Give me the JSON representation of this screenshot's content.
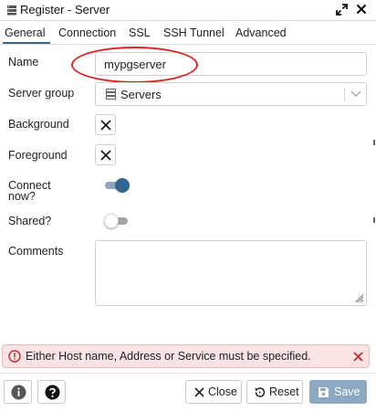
{
  "window": {
    "title": "Register - Server"
  },
  "tabs": [
    {
      "label": "General"
    },
    {
      "label": "Connection"
    },
    {
      "label": "SSL"
    },
    {
      "label": "SSH Tunnel"
    },
    {
      "label": "Advanced"
    }
  ],
  "form": {
    "name": {
      "label": "Name",
      "value": "mypgserver"
    },
    "server_group": {
      "label": "Server group",
      "value": "Servers"
    },
    "background": {
      "label": "Background"
    },
    "foreground": {
      "label": "Foreground"
    },
    "connect_now": {
      "label_line1": "Connect",
      "label_line2": "now?",
      "enabled": true
    },
    "shared": {
      "label": "Shared?",
      "enabled": false
    },
    "comments": {
      "label": "Comments",
      "value": ""
    }
  },
  "error": {
    "message": "Either Host name, Address or Service must be specified."
  },
  "footer": {
    "close_label": "Close",
    "reset_label": "Reset",
    "save_label": "Save"
  },
  "colors": {
    "accent": "#326690",
    "save_button": "#8da8c3",
    "error_background": "#f9e3e4",
    "error_icon": "#c7282f",
    "annotation": "#dd2222"
  },
  "icons": {
    "title": "server-group-icon",
    "expand": "expand-icon",
    "close": "close-icon",
    "server_group": "server-group-icon",
    "chevron": "chevron-down-icon",
    "error": "error-circle-icon",
    "info": "info-icon",
    "help": "help-icon",
    "close_button": "close-icon",
    "reset_button": "reset-icon",
    "save_button": "save-icon"
  }
}
